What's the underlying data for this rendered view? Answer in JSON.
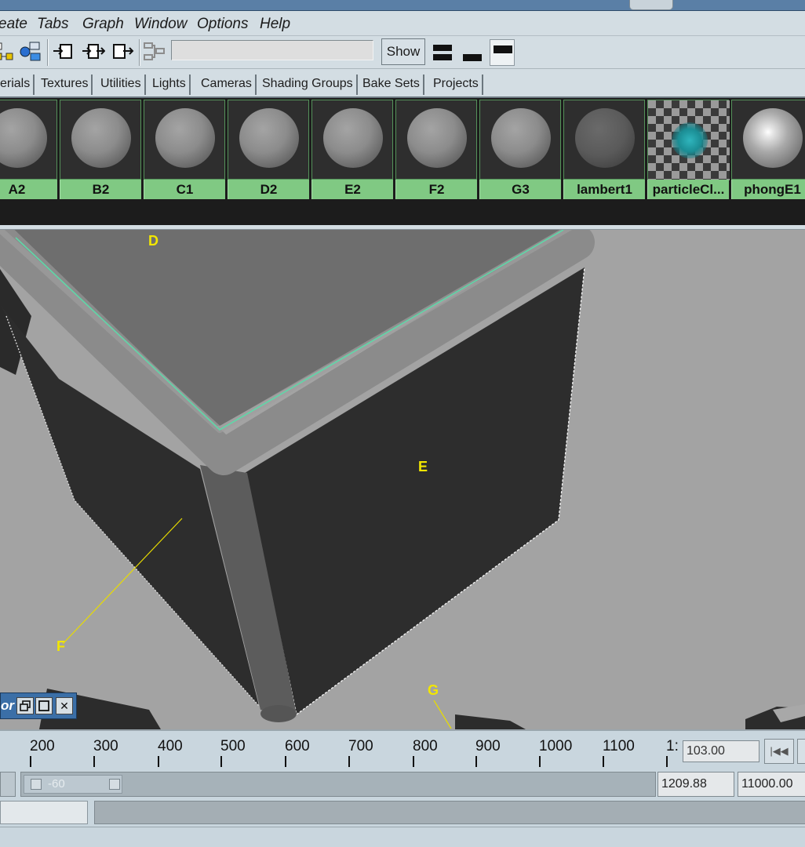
{
  "menu": [
    "eate",
    "Tabs",
    "Graph",
    "Window",
    "Options",
    "Help"
  ],
  "toolbar": {
    "show_label": "Show",
    "filter_value": ""
  },
  "tabs": [
    "erials",
    "Textures",
    "Utilities",
    "Lights",
    "Cameras",
    "Shading Groups",
    "Bake Sets",
    "Projects"
  ],
  "swatches": [
    {
      "label": "A2",
      "kind": "grey"
    },
    {
      "label": "B2",
      "kind": "grey"
    },
    {
      "label": "C1",
      "kind": "grey"
    },
    {
      "label": "D2",
      "kind": "grey"
    },
    {
      "label": "E2",
      "kind": "grey"
    },
    {
      "label": "F2",
      "kind": "grey"
    },
    {
      "label": "G3",
      "kind": "grey"
    },
    {
      "label": "lambert1",
      "kind": "dark"
    },
    {
      "label": "particleCl...",
      "kind": "checker"
    },
    {
      "label": "phongE1",
      "kind": "phong"
    }
  ],
  "viewport": {
    "labels": {
      "d": "D",
      "e": "E",
      "f": "F",
      "g": "G"
    }
  },
  "mini_window": {
    "title": "or",
    "restore_icon": "restore-icon",
    "maximize_icon": "maximize-icon",
    "close_icon": "close-icon",
    "close_glyph": "✕"
  },
  "timeline": {
    "ticks": [
      "200",
      "300",
      "400",
      "500",
      "600",
      "700",
      "800",
      "900",
      "1000",
      "1100",
      "1:"
    ],
    "current_time": "103.00",
    "goto_start_glyph": "|◀◀"
  },
  "range": {
    "start_value": "-60",
    "playback_end": "1209.88",
    "animation_end": "11000.00"
  },
  "colors": {
    "swatch_label_bg": "#80c983",
    "viewport_bg": "#a3a3a3",
    "annotation": "#f2e600",
    "selection_edge": "#5fd7a8"
  }
}
